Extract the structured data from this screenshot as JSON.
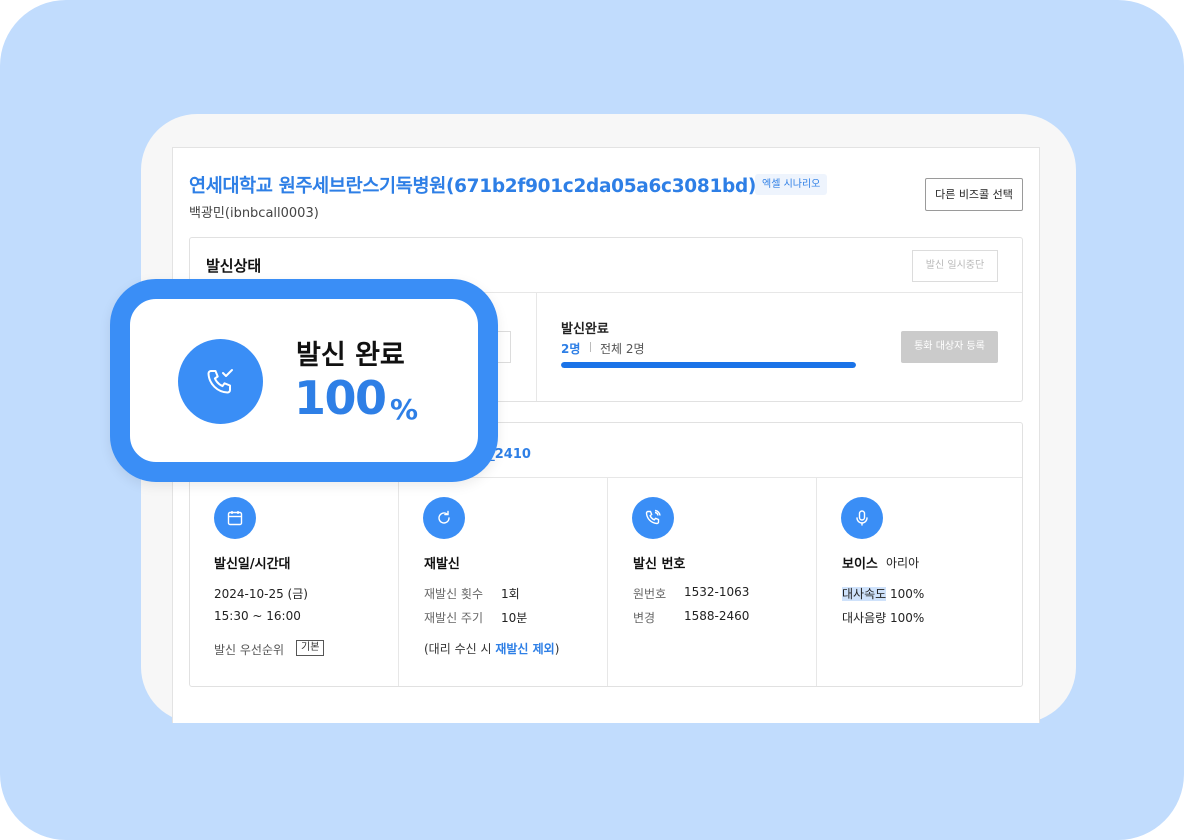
{
  "header": {
    "title": "연세대학교 원주세브란스기독병원(671b2f901c2da05a6c3081bd)",
    "scenario_tag": "엑셀 시나리오",
    "subtitle": "백광민(ibnbcall0003)",
    "other_bizcall_button": "다른 비즈콜 선택"
  },
  "status": {
    "title": "발신상태",
    "pause_button": "발신 일시중단",
    "completed_label": "발신완료",
    "completed_count": "2명",
    "total": "전체 2명",
    "progress_ratio": 1.0,
    "register_button": "통화 대상자 등록"
  },
  "callout": {
    "label": "발신 완료",
    "value": "100",
    "unit": "%",
    "icon": "phone-check-icon"
  },
  "scenario": {
    "name": "과대학 시나리오_2410"
  },
  "details": {
    "schedule": {
      "icon": "calendar-icon",
      "title": "발신일/시간대",
      "date": "2024-10-25 (금)",
      "time": "15:30 ~ 16:00",
      "priority_label": "발신 우선순위",
      "priority_value": "기본"
    },
    "redial": {
      "icon": "refresh-icon",
      "title": "재발신",
      "count_label": "재발신 횟수",
      "count_value": "1회",
      "interval_label": "재발신 주기",
      "interval_value": "10분",
      "note_prefix": "(대리 수신 시 ",
      "note_highlight": "재발신 제외",
      "note_suffix": ")"
    },
    "caller_number": {
      "icon": "phone-icon",
      "title": "발신 번호",
      "original_label": "원번호",
      "original_value": "1532-1063",
      "changed_label": "변경",
      "changed_value": "1588-2460"
    },
    "voice": {
      "icon": "microphone-icon",
      "title": "보이스",
      "voice_name": "아리아",
      "speed_label": "대사속도",
      "speed_value": "100%",
      "volume_label": "대사음량",
      "volume_value": "100%"
    }
  },
  "colors": {
    "accent": "#2e7fe6",
    "icon_circle": "#3a8ef6",
    "background": "#c1dcfd"
  }
}
